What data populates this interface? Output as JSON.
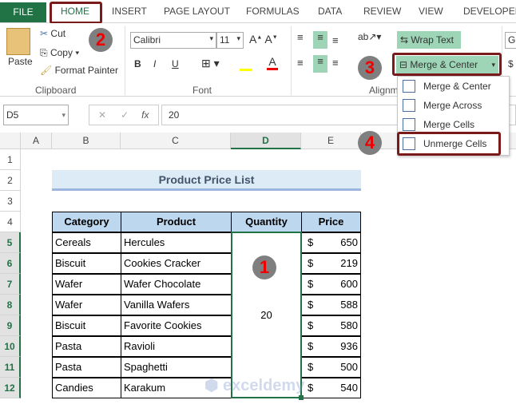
{
  "tabs": [
    "FILE",
    "HOME",
    "INSERT",
    "PAGE LAYOUT",
    "FORMULAS",
    "DATA",
    "REVIEW",
    "VIEW",
    "DEVELOPER"
  ],
  "clipboard": {
    "paste": "Paste",
    "cut": "Cut",
    "copy": "Copy",
    "format_painter": "Format Painter",
    "label": "Clipboard"
  },
  "font": {
    "name": "Calibri",
    "size": "11",
    "bold": "B",
    "italic": "I",
    "underline": "U",
    "label": "Font"
  },
  "alignment": {
    "wrap_text": "Wrap Text",
    "merge_center": "Merge & Center",
    "label": "Alignm"
  },
  "number": {
    "format_partial": "G",
    "currency": "$"
  },
  "merge_menu": [
    "Merge & Center",
    "Merge Across",
    "Merge Cells",
    "Unmerge Cells"
  ],
  "formula_bar": {
    "name_box": "D5",
    "fx": "fx",
    "value": "20"
  },
  "columns": [
    "A",
    "B",
    "C",
    "D",
    "E"
  ],
  "rows": [
    "1",
    "2",
    "3",
    "4",
    "5",
    "6",
    "7",
    "8",
    "9",
    "10",
    "11",
    "12"
  ],
  "sheet": {
    "title": "Product Price List",
    "headers": [
      "Category",
      "Product",
      "Quantity",
      "Price"
    ],
    "quantity_merged": "20",
    "currency": "$",
    "data": [
      [
        "Cereals",
        "Hercules",
        "650"
      ],
      [
        "Biscuit",
        "Cookies Cracker",
        "219"
      ],
      [
        "Wafer",
        "Wafer Chocolate",
        "600"
      ],
      [
        "Wafer",
        "Vanilla Wafers",
        "588"
      ],
      [
        "Biscuit",
        "Favorite Cookies",
        "580"
      ],
      [
        "Pasta",
        "Ravioli",
        "936"
      ],
      [
        "Pasta",
        "Spaghetti",
        "500"
      ],
      [
        "Candies",
        "Karakum",
        "540"
      ]
    ]
  },
  "steps": [
    "1",
    "2",
    "3",
    "4"
  ],
  "watermark": "exceldemy",
  "colors": {
    "excel_green": "#217346",
    "header_fill": "#bdd7ee",
    "title_fill": "#ddebf7",
    "highlight": "#7b1a1a",
    "active_button": "#9fd5b7"
  }
}
